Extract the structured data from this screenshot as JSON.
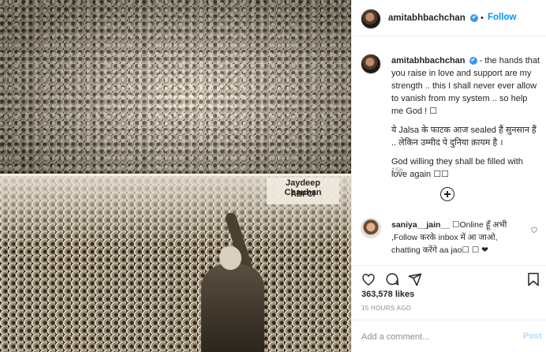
{
  "post": {
    "photo": {
      "sign_line1": "Jaydeep Chauhan",
      "sign_line2": "ABFCI"
    },
    "header": {
      "username": "amitabhbachchan",
      "verified_mark": "✔",
      "dot": "•",
      "follow_label": "Follow"
    },
    "caption": {
      "username": "amitabhbachchan",
      "verified_mark": "✔",
      "text_1": " - the hands that you raise in love and support are my strength .. this I shall never ever allow to vanish from my system .. so help me God ! ☐",
      "text_2": "ये Jalsa के फाटक आज sealed हैं सुनसान हैं .. लेकिन उम्मीद पे दुनिया क़ायम है ।",
      "text_3": "God willing they shall be filled with love again ☐☐",
      "time": "15h"
    },
    "comment": {
      "username": "saniya__jain__",
      "text": " ☐Online हूँ अभी ,Follow करके inbox में आ जाओ, chatting करेंगे aa jao☐ ☐ ❤"
    },
    "stats": {
      "likes": "363,578 likes",
      "posted": "15 HOURS AGO"
    },
    "add_comment": {
      "placeholder": "Add a comment...",
      "post_label": "Post"
    }
  },
  "colors": {
    "accent": "#0095f6",
    "verified": "#3897f0",
    "post_disabled": "#b3dbff",
    "muted": "#8e8e8e",
    "text": "#262626",
    "photo_tone": "sepia"
  },
  "icons": [
    "heart-icon",
    "comment-icon",
    "share-icon",
    "save-icon",
    "plus-circle-icon",
    "verified-badge-icon"
  ]
}
